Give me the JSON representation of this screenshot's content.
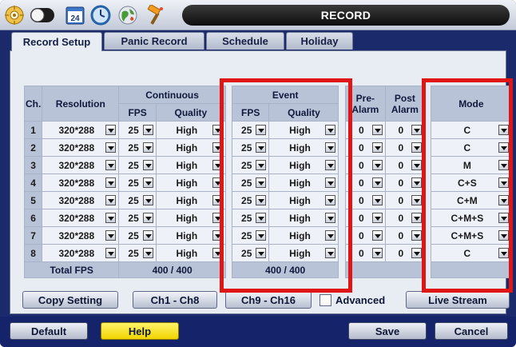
{
  "window": {
    "title": "RECORD"
  },
  "toolbar_icons": [
    "gear-icon",
    "toggle-icon",
    "calendar-icon",
    "clock-icon",
    "globe-icon",
    "hammer-icon"
  ],
  "calendar_day": "24",
  "tabs": [
    {
      "label": "Record Setup",
      "active": true
    },
    {
      "label": "Panic Record",
      "active": false
    },
    {
      "label": "Schedule",
      "active": false
    },
    {
      "label": "Holiday",
      "active": false
    }
  ],
  "table": {
    "headers": {
      "ch": "Ch.",
      "resolution": "Resolution",
      "continuous": "Continuous",
      "event": "Event",
      "fps": "FPS",
      "quality": "Quality",
      "pre_alarm": "Pre-\nAlarm",
      "pre_alarm_l1": "Pre-",
      "pre_alarm_l2": "Alarm",
      "post_alarm_l1": "Post",
      "post_alarm_l2": "Alarm",
      "mode": "Mode"
    },
    "rows": [
      {
        "ch": "1",
        "resolution": "320*288",
        "cont_fps": "25",
        "cont_quality": "High",
        "event_fps": "25",
        "event_quality": "High",
        "pre_alarm": "0",
        "post_alarm": "0",
        "mode": "C"
      },
      {
        "ch": "2",
        "resolution": "320*288",
        "cont_fps": "25",
        "cont_quality": "High",
        "event_fps": "25",
        "event_quality": "High",
        "pre_alarm": "0",
        "post_alarm": "0",
        "mode": "C"
      },
      {
        "ch": "3",
        "resolution": "320*288",
        "cont_fps": "25",
        "cont_quality": "High",
        "event_fps": "25",
        "event_quality": "High",
        "pre_alarm": "0",
        "post_alarm": "0",
        "mode": "M"
      },
      {
        "ch": "4",
        "resolution": "320*288",
        "cont_fps": "25",
        "cont_quality": "High",
        "event_fps": "25",
        "event_quality": "High",
        "pre_alarm": "0",
        "post_alarm": "0",
        "mode": "C+S"
      },
      {
        "ch": "5",
        "resolution": "320*288",
        "cont_fps": "25",
        "cont_quality": "High",
        "event_fps": "25",
        "event_quality": "High",
        "pre_alarm": "0",
        "post_alarm": "0",
        "mode": "C+M"
      },
      {
        "ch": "6",
        "resolution": "320*288",
        "cont_fps": "25",
        "cont_quality": "High",
        "event_fps": "25",
        "event_quality": "High",
        "pre_alarm": "0",
        "post_alarm": "0",
        "mode": "C+M+S"
      },
      {
        "ch": "7",
        "resolution": "320*288",
        "cont_fps": "25",
        "cont_quality": "High",
        "event_fps": "25",
        "event_quality": "High",
        "pre_alarm": "0",
        "post_alarm": "0",
        "mode": "C+M+S"
      },
      {
        "ch": "8",
        "resolution": "320*288",
        "cont_fps": "25",
        "cont_quality": "High",
        "event_fps": "25",
        "event_quality": "High",
        "pre_alarm": "0",
        "post_alarm": "0",
        "mode": "C"
      }
    ],
    "total": {
      "label": "Total FPS",
      "continuous": "400 / 400",
      "event": "400 / 400"
    }
  },
  "buttons": {
    "copy_setting": "Copy Setting",
    "ch1_ch8": "Ch1 - Ch8",
    "ch9_ch16": "Ch9 - Ch16",
    "advanced": "Advanced",
    "live_stream": "Live Stream"
  },
  "footer": {
    "default": "Default",
    "help": "Help",
    "save": "Save",
    "cancel": "Cancel"
  },
  "colors": {
    "highlight": "#e01616",
    "help_button": "#f5de1a",
    "frame": "#15236a"
  }
}
